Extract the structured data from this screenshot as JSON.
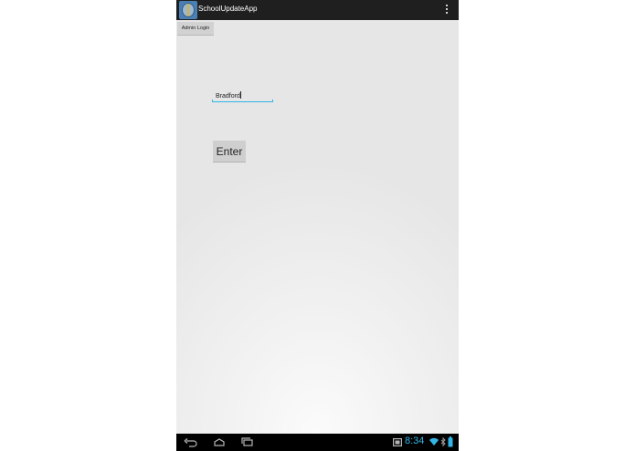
{
  "action_bar": {
    "title": "SchoolUpdateApp",
    "app_icon": "school-app-icon",
    "menu_icon": "overflow-menu-icon"
  },
  "content": {
    "admin_button_label": "Admin Login",
    "school_input_value": "Bradford",
    "enter_button_label": "Enter"
  },
  "nav_bar": {
    "back_icon": "back-icon",
    "home_icon": "home-icon",
    "recents_icon": "recents-icon"
  },
  "status_bar": {
    "time": "8:34",
    "icons": [
      "screenshot-icon",
      "wifi-icon",
      "bluetooth-icon",
      "battery-icon"
    ]
  },
  "colors": {
    "accent": "#33b5e5",
    "action_bar": "#1f1f1f",
    "button": "#cfcfcf"
  }
}
